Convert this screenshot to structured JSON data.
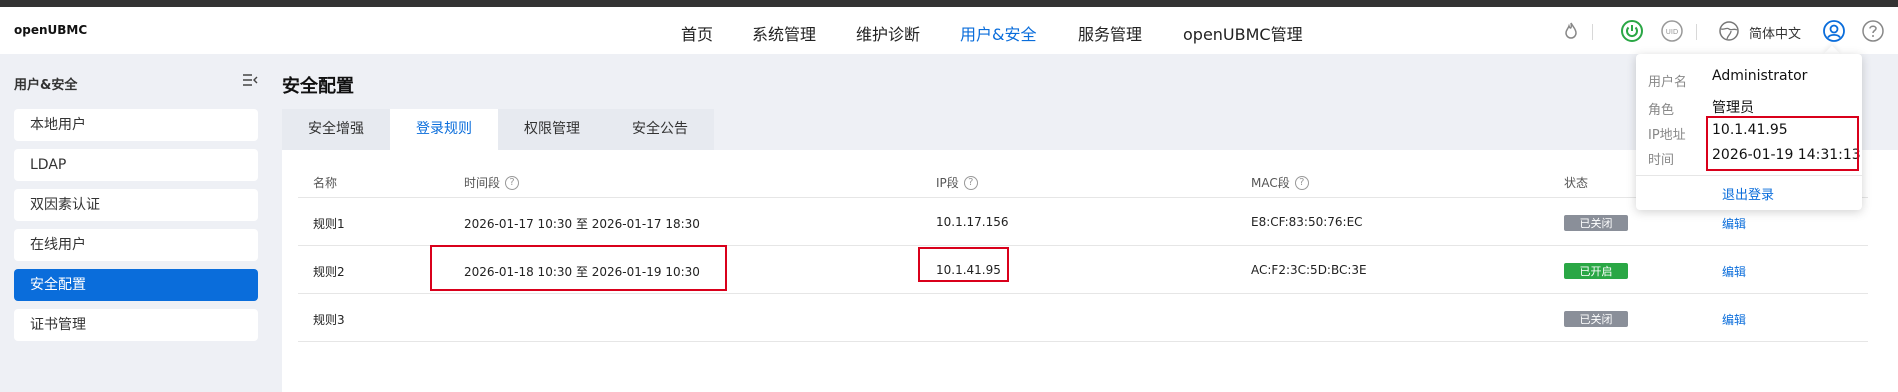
{
  "brand": "openUBMC",
  "nav": {
    "items": [
      "首页",
      "系统管理",
      "维护诊断",
      "用户&安全",
      "服务管理",
      "openUBMC管理"
    ],
    "active_index": 3
  },
  "header_right": {
    "icons": [
      "flame-icon",
      "power-icon",
      "uid-icon",
      "globe-icon",
      "user-icon",
      "help-icon"
    ],
    "language": "简体中文",
    "uid_text": "UID"
  },
  "sidebar": {
    "title": "用户&安全",
    "items": [
      "本地用户",
      "LDAP",
      "双因素认证",
      "在线用户",
      "安全配置",
      "证书管理"
    ],
    "active_index": 4
  },
  "page": {
    "title": "安全配置",
    "tabs": [
      "安全增强",
      "登录规则",
      "权限管理",
      "安全公告"
    ],
    "active_tab": 1
  },
  "table": {
    "headers": [
      "名称",
      "时间段",
      "IP段",
      "MAC段",
      "状态"
    ],
    "header_help": [
      false,
      true,
      true,
      true,
      false
    ],
    "rows": [
      {
        "name": "规则1",
        "time": "2026-01-17 10:30 至 2026-01-17 18:30",
        "ip": "10.1.17.156",
        "mac": "E8:CF:83:50:76:EC",
        "status": "已关闭",
        "status_on": false,
        "action": "编辑"
      },
      {
        "name": "规则2",
        "time": "2026-01-18 10:30 至 2026-01-19 10:30",
        "ip": "10.1.41.95",
        "mac": "AC:F2:3C:5D:BC:3E",
        "status": "已开启",
        "status_on": true,
        "action": "编辑"
      },
      {
        "name": "规则3",
        "time": "",
        "ip": "",
        "mac": "",
        "status": "已关闭",
        "status_on": false,
        "action": "编辑"
      }
    ]
  },
  "user_popover": {
    "username_label": "用户名",
    "username": "Administrator",
    "role_label": "角色",
    "role": "管理员",
    "ip_label": "IP地址",
    "ip": "10.1.41.95",
    "time_label": "时间",
    "time": "2026-01-19 14:31:13",
    "logout": "退出登录"
  },
  "colors": {
    "accent": "#0a6ddb",
    "status_on": "#2aa745",
    "status_off": "#8a8f99",
    "highlight": "#d9001b"
  }
}
